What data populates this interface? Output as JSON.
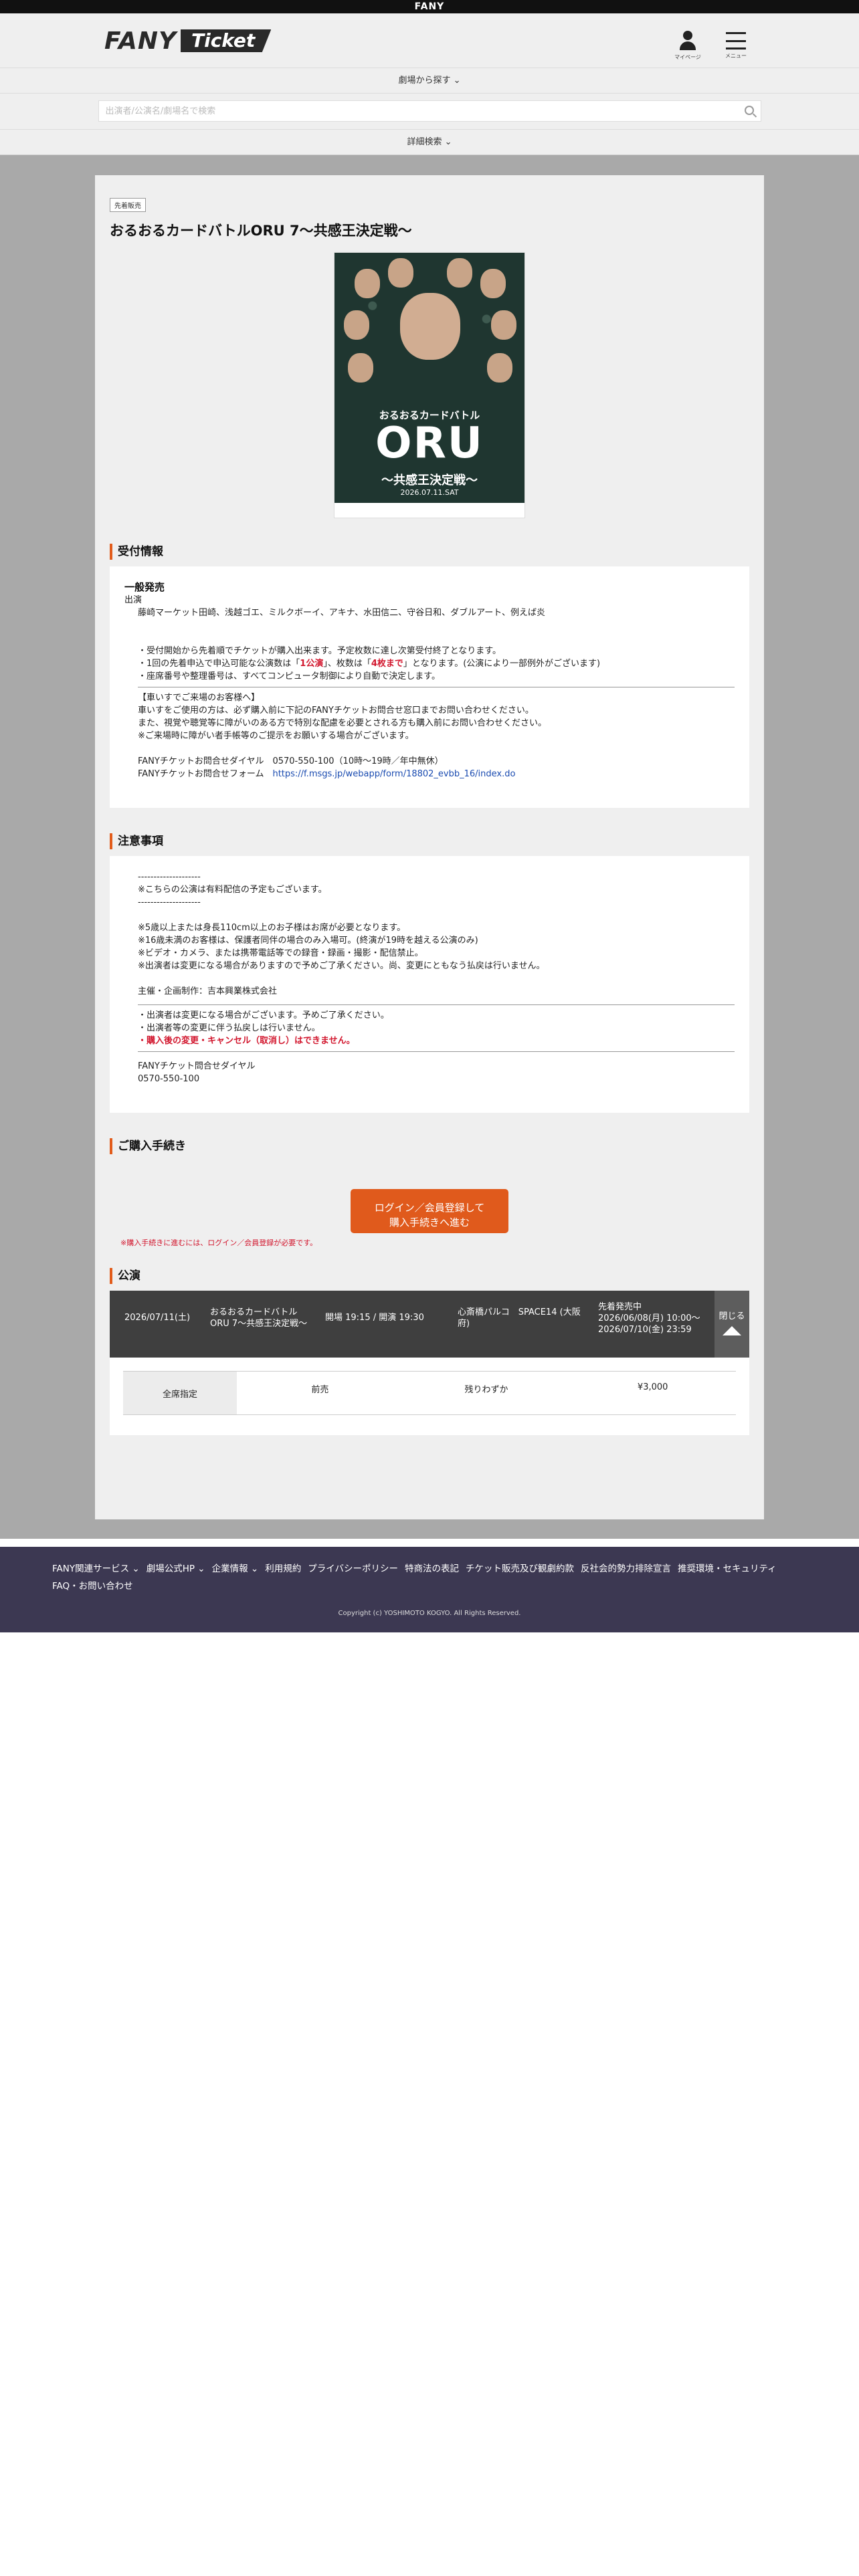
{
  "topbar": {
    "brand": "FANY"
  },
  "header": {
    "logo_fany": "FANY",
    "logo_ticket": "Ticket",
    "mypage_label": "マイページ",
    "menu_label": "メニュー"
  },
  "nav": {
    "find_by_theater": "劇場から探す ⌄",
    "search_placeholder": "出演者/公演名/劇場名で検索",
    "advanced_search": "詳細検索 ⌄"
  },
  "event": {
    "badge": "先着販売",
    "title": "おるおるカードバトルORU 7〜共感王決定戦〜",
    "poster": {
      "subtitle": "おるおるカードバトル",
      "big": "ORU",
      "theme": "〜共感王決定戦〜",
      "date": "2026.07.11.SAT"
    }
  },
  "reception": {
    "heading": "受付情報",
    "sale_type": "一般発売",
    "cast_label": "出演",
    "cast": "藤崎マーケット田崎、浅越ゴエ、ミルクボーイ、アキナ、水田信二、守谷日和、ダブルアート、例えば炎",
    "rule1": "・受付開始から先着順でチケットが購入出来ます。予定枚数に達し次第受付終了となります。",
    "rule2_a": "・1回の先着申込で申込可能な公演数は「",
    "rule2_b": "1公演",
    "rule2_c": "」、枚数は「",
    "rule2_d": "4枚まで",
    "rule2_e": "」となります。(公演により一部例外がございます)",
    "rule3": "・座席番号や整理番号は、すべてコンピュータ制御により自動で決定します。",
    "wheel_title": "【車いすでご来場のお客様へ】",
    "wheel1": "車いすをご使用の方は、必ず購入前に下記のFANYチケットお問合せ窓口までお問い合わせください。",
    "wheel2": "また、視覚や聴覚等に障がいのある方で特別な配慮を必要とされる方も購入前にお問い合わせください。",
    "wheel3": "※ご来場時に障がい者手帳等のご提示をお願いする場合がございます。",
    "contact_dial": "FANYチケットお問合せダイヤル　0570-550-100（10時〜19時／年中無休）",
    "contact_form_label": "FANYチケットお問合せフォーム　",
    "contact_form_url": "https://f.msgs.jp/webapp/form/18802_evbb_16/index.do"
  },
  "notes": {
    "heading": "注意事項",
    "sep": "--------------------",
    "stream": "※こちらの公演は有料配信の予定もございます。",
    "n1": "※5歳以上または身長110cm以上のお子様はお席が必要となります。",
    "n2": "※16歳未満のお客様は、保護者同伴の場合のみ入場可。(終演が19時を越える公演のみ)",
    "n3": "※ビデオ・カメラ、または携帯電話等での録音・録画・撮影・配信禁止。",
    "n4": "※出演者は変更になる場合がありますので予めご了承ください。尚、変更にともなう払戻は行いません。",
    "organizer": "主催・企画制作：吉本興業株式会社",
    "c1": "・出演者は変更になる場合がございます。予めご了承ください。",
    "c2": "・出演者等の変更に伴う払戻しは行いません。",
    "c3": "・購入後の変更・キャンセル（取消し）はできません。",
    "dial_label": "FANYチケット問合せダイヤル",
    "dial_number": "0570-550-100"
  },
  "purchase": {
    "heading": "ご購入手続き",
    "button_line1": "ログイン／会員登録して",
    "button_line2": "購入手続きへ進む",
    "note": "※購入手続きに進むには、ログイン／会員登録が必要です。"
  },
  "performance": {
    "heading": "公演",
    "date": "2026/07/11(土)",
    "name_line1": "おるおるカードバトル",
    "name_line2": "ORU 7〜共感王決定戦〜",
    "times": "開場 19:15 / 開演 19:30",
    "venue_line1": "心斎橋パルコ　SPACE14 (大阪",
    "venue_line2": "府)",
    "sale_status": "先着発売中",
    "sale_from": "2026/06/08(月) 10:00〜",
    "sale_to": "2026/07/10(金) 23:59",
    "close_label": "閉じる",
    "seat_type": "全席指定",
    "seat_presale": "前売",
    "seat_avail": "残りわずか",
    "seat_price": "¥3,000"
  },
  "footer": {
    "links": [
      "FANY関連サービス ⌄",
      "劇場公式HP ⌄",
      "企業情報 ⌄",
      "利用規約",
      "プライバシーポリシー",
      "特商法の表記",
      "チケット販売及び観劇約款",
      "反社会的勢力排除宣言",
      "推奨環境・セキュリティ",
      "FAQ・お問い合わせ"
    ],
    "copyright": "Copyright (c) YOSHIMOTO KOGYO. All Rights Reserved."
  }
}
